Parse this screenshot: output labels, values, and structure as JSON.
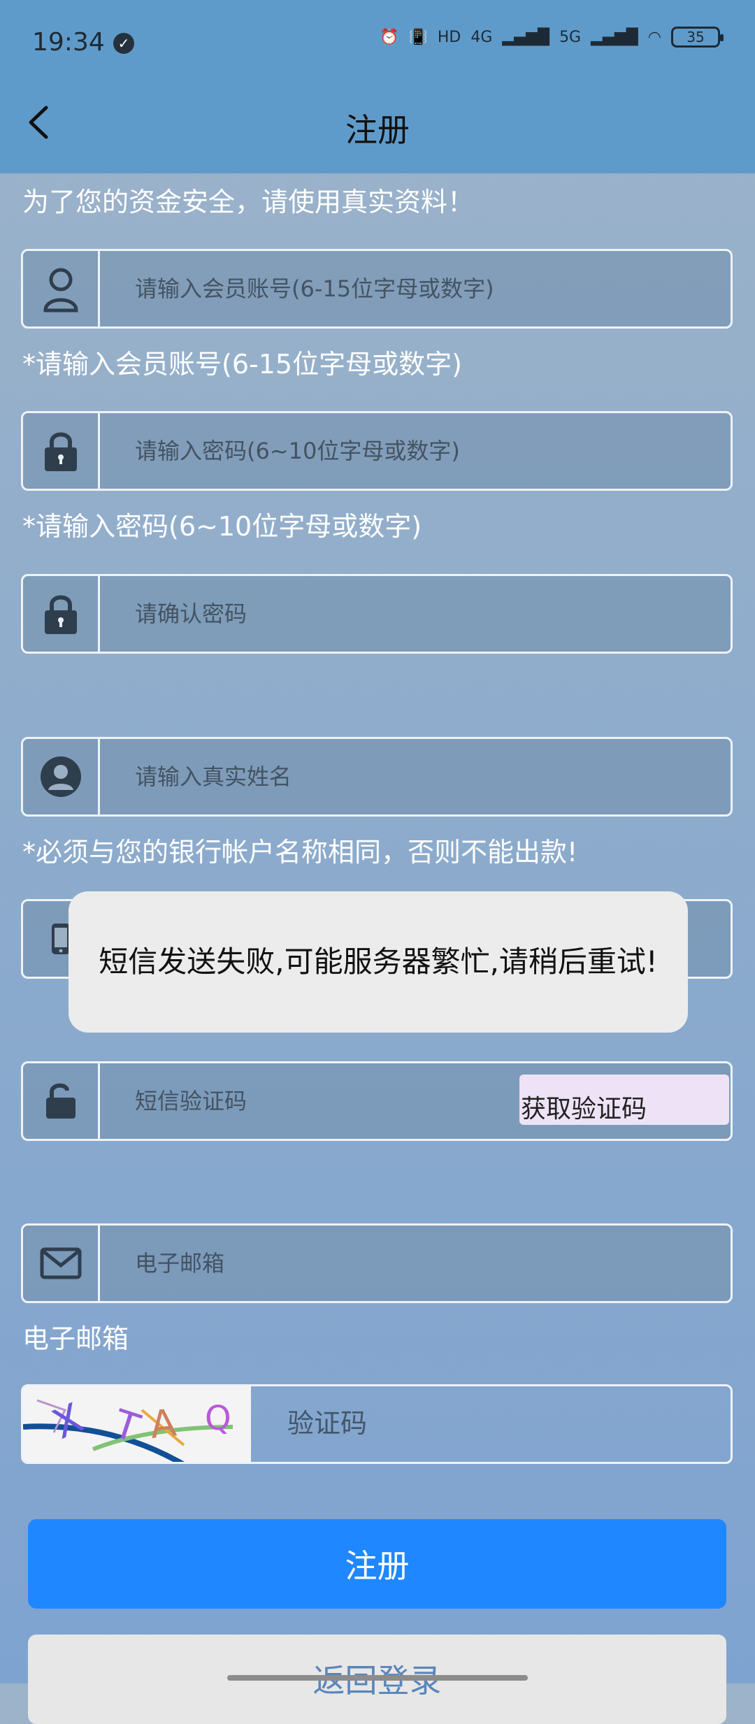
{
  "status_bar": {
    "time": "19:34",
    "hd_label": "HD",
    "network_4g": "4G",
    "network_5g": "5G",
    "battery": "35"
  },
  "header": {
    "title": "注册"
  },
  "form": {
    "intro_text": "为了您的资金安全，请使用真实资料！",
    "account_placeholder": "请输入会员账号(6-15位字母或数字)",
    "account_hint": "*请输入会员账号(6-15位字母或数字)",
    "password_placeholder": "请输入密码(6~10位字母或数字)",
    "password_hint": "*请输入密码(6~10位字母或数字)",
    "confirm_password_placeholder": "请确认密码",
    "real_name_placeholder": "请输入真实姓名",
    "real_name_hint": "*必须与您的银行帐户名称相同，否则不能出款!",
    "sms_code_placeholder": "短信验证码",
    "get_code_button": "获取验证码",
    "email_placeholder": "电子邮箱",
    "email_hint": "电子邮箱",
    "captcha_placeholder": "验证码",
    "captcha_text": "XTAQ"
  },
  "toast": {
    "message": "短信发送失败,可能服务器繁忙,请稍后重试!"
  },
  "buttons": {
    "register": "注册",
    "back_to_login": "返回登录"
  },
  "colors": {
    "header_bg": "#5f9bca",
    "primary_button": "#1f87ff",
    "secondary_button": "#e7e7e7",
    "toast_bg": "#ececec"
  }
}
